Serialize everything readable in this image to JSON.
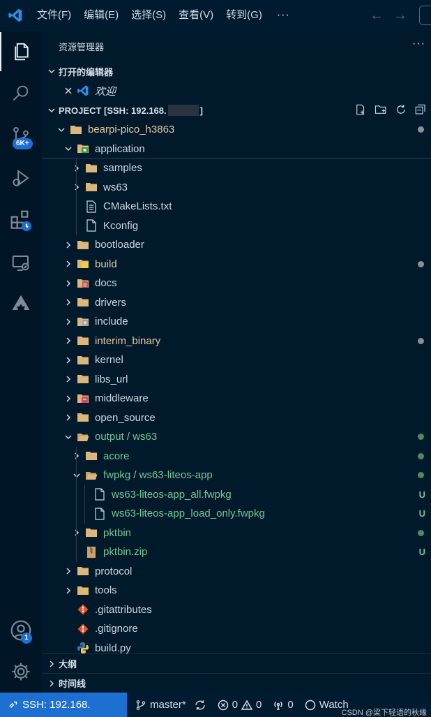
{
  "menubar": {
    "items": [
      "文件(F)",
      "编辑(E)",
      "选择(S)",
      "查看(V)",
      "转到(G)"
    ],
    "more": "···"
  },
  "activity": {
    "scm_badge": "6K+",
    "account_badge": "1"
  },
  "explorer": {
    "title": "资源管理器",
    "more": "···",
    "open_editors_label": "打开的编辑器",
    "open_editor_item": "欢迎",
    "project_label": "PROJECT [SSH: 192.168.",
    "project_suffix": "]"
  },
  "tree": [
    {
      "label": "bearpi-pico_h3863",
      "depth": 0,
      "twisty": "open",
      "icon": "folder-icon",
      "color": "#e6c8a0",
      "status_kind": "dot",
      "status_color": "#8a8f96"
    },
    {
      "label": "application",
      "depth": 1,
      "twisty": "open",
      "icon": "folder-app-icon",
      "color": "#cfd6e0"
    },
    {
      "label": "samples",
      "depth": 2,
      "twisty": "closed",
      "icon": "folder-icon",
      "color": "#cfd6e0"
    },
    {
      "label": "ws63",
      "depth": 2,
      "twisty": "closed",
      "icon": "folder-icon",
      "color": "#cfd6e0"
    },
    {
      "label": "CMakeLists.txt",
      "depth": 2,
      "twisty": "none",
      "icon": "cmake-file-icon",
      "color": "#cfd6e0"
    },
    {
      "label": "Kconfig",
      "depth": 2,
      "twisty": "none",
      "icon": "file-icon",
      "color": "#cfd6e0"
    },
    {
      "label": "bootloader",
      "depth": 1,
      "twisty": "closed",
      "icon": "folder-icon",
      "color": "#cfd6e0"
    },
    {
      "label": "build",
      "depth": 1,
      "twisty": "closed",
      "icon": "folder-build-icon",
      "color": "#e6c8a0",
      "status_kind": "dot",
      "status_color": "#8a8f96"
    },
    {
      "label": "docs",
      "depth": 1,
      "twisty": "closed",
      "icon": "folder-docs-icon",
      "color": "#cfd6e0"
    },
    {
      "label": "drivers",
      "depth": 1,
      "twisty": "closed",
      "icon": "folder-icon",
      "color": "#cfd6e0"
    },
    {
      "label": "include",
      "depth": 1,
      "twisty": "closed",
      "icon": "folder-include-icon",
      "color": "#cfd6e0"
    },
    {
      "label": "interim_binary",
      "depth": 1,
      "twisty": "closed",
      "icon": "folder-icon",
      "color": "#e6c8a0",
      "status_kind": "dot",
      "status_color": "#8a8f96"
    },
    {
      "label": "kernel",
      "depth": 1,
      "twisty": "closed",
      "icon": "folder-icon",
      "color": "#cfd6e0"
    },
    {
      "label": "libs_url",
      "depth": 1,
      "twisty": "closed",
      "icon": "folder-icon",
      "color": "#cfd6e0"
    },
    {
      "label": "middleware",
      "depth": 1,
      "twisty": "closed",
      "icon": "folder-middleware-icon",
      "color": "#cfd6e0"
    },
    {
      "label": "open_source",
      "depth": 1,
      "twisty": "closed",
      "icon": "folder-icon",
      "color": "#cfd6e0"
    },
    {
      "label": "output / ws63",
      "depth": 1,
      "twisty": "open",
      "icon": "folder-open-icon",
      "color": "#73c991",
      "status_kind": "dot",
      "status_color": "#4d8a63"
    },
    {
      "label": "acore",
      "depth": 2,
      "twisty": "closed",
      "icon": "folder-icon",
      "color": "#73c991",
      "status_kind": "dot",
      "status_color": "#4d8a63"
    },
    {
      "label": "fwpkg / ws63-liteos-app",
      "depth": 2,
      "twisty": "open",
      "icon": "folder-open-icon",
      "color": "#73c991",
      "status_kind": "dot",
      "status_color": "#4d8a63"
    },
    {
      "label": "ws63-liteos-app_all.fwpkg",
      "depth": 3,
      "twisty": "none",
      "icon": "file-icon",
      "color": "#73c991",
      "status_kind": "text",
      "status_text": "U",
      "status_color": "#73c991"
    },
    {
      "label": "ws63-liteos-app_load_only.fwpkg",
      "depth": 3,
      "twisty": "none",
      "icon": "file-icon",
      "color": "#73c991",
      "status_kind": "text",
      "status_text": "U",
      "status_color": "#73c991"
    },
    {
      "label": "pktbin",
      "depth": 2,
      "twisty": "closed",
      "icon": "folder-icon",
      "color": "#73c991",
      "status_kind": "dot",
      "status_color": "#4d8a63"
    },
    {
      "label": "pktbin.zip",
      "depth": 2,
      "twisty": "none",
      "icon": "zip-file-icon",
      "color": "#73c991",
      "status_kind": "text",
      "status_text": "U",
      "status_color": "#73c991"
    },
    {
      "label": "protocol",
      "depth": 1,
      "twisty": "closed",
      "icon": "folder-icon",
      "color": "#cfd6e0"
    },
    {
      "label": "tools",
      "depth": 1,
      "twisty": "closed",
      "icon": "folder-tools-icon",
      "color": "#cfd6e0"
    },
    {
      "label": ".gitattributes",
      "depth": 1,
      "twisty": "none",
      "icon": "git-icon",
      "color": "#cfd6e0"
    },
    {
      "label": ".gitignore",
      "depth": 1,
      "twisty": "none",
      "icon": "git-icon",
      "color": "#cfd6e0"
    },
    {
      "label": "build.py",
      "depth": 1,
      "twisty": "none",
      "icon": "python-icon",
      "color": "#cfd6e0"
    }
  ],
  "bottom_sections": {
    "outline": "大纲",
    "timeline": "时间线"
  },
  "statusbar": {
    "remote": "SSH: 192.168.",
    "branch": "master*",
    "errors": "0",
    "warnings": "0",
    "ports": "0",
    "watch": "Watch"
  },
  "watermark": "CSDN @梁下轻语的秋缘",
  "colors": {
    "accent": "#1d6fd1",
    "untracked": "#73c991",
    "modified": "#e6c8a0"
  }
}
